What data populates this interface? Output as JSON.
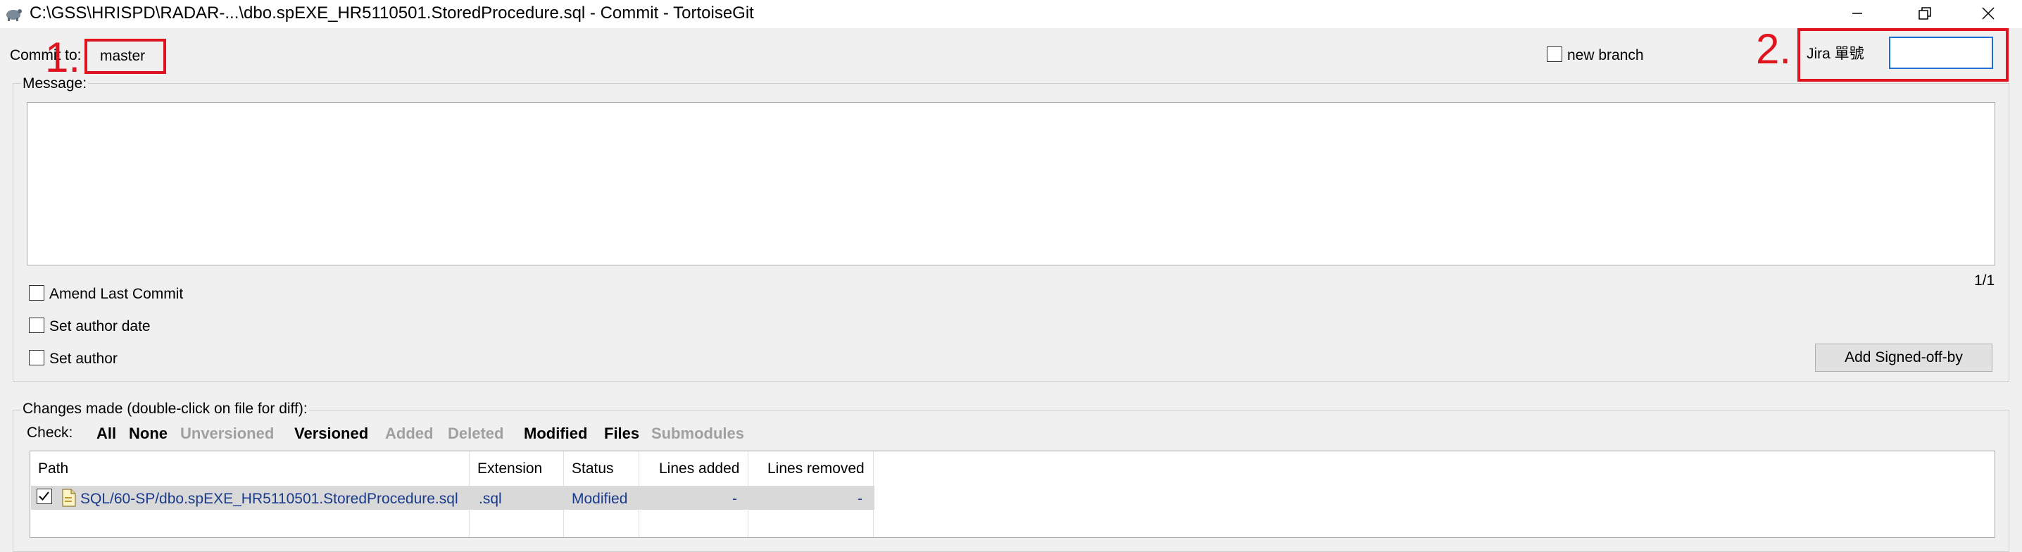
{
  "window": {
    "title": "C:\\GSS\\HRISPD\\RADAR-...\\dbo.spEXE_HR5110501.StoredProcedure.sql - Commit - TortoiseGit",
    "minimize_icon": "minimize-icon",
    "restore_icon": "restore-icon",
    "close_icon": "close-icon"
  },
  "commit": {
    "commit_to_label": "Commit to:",
    "branch": "master",
    "new_branch_label": "new branch",
    "jira_label": "Jira 單號",
    "jira_value": ""
  },
  "annotations": {
    "one": "1.",
    "two": "2."
  },
  "message": {
    "label": "Message:",
    "value": "",
    "counter": "1/1"
  },
  "options": {
    "amend": "Amend Last Commit",
    "set_author_date": "Set author date",
    "set_author": "Set author",
    "signed_off_button": "Add Signed-off-by"
  },
  "changes": {
    "group_label": "Changes made (double-click on file for diff):",
    "check_label": "Check:",
    "filters": [
      {
        "label": "All",
        "enabled": true
      },
      {
        "label": "None",
        "enabled": true
      },
      {
        "label": "Unversioned",
        "enabled": false
      },
      {
        "label": "Versioned",
        "enabled": true
      },
      {
        "label": "Added",
        "enabled": false
      },
      {
        "label": "Deleted",
        "enabled": false
      },
      {
        "label": "Modified",
        "enabled": true
      },
      {
        "label": "Files",
        "enabled": true
      },
      {
        "label": "Submodules",
        "enabled": false
      }
    ],
    "columns": [
      "Path",
      "Extension",
      "Status",
      "Lines added",
      "Lines removed"
    ],
    "rows": [
      {
        "checked": true,
        "path": "SQL/60-SP/dbo.spEXE_HR5110501.StoredProcedure.sql",
        "extension": ".sql",
        "status": "Modified",
        "lines_added": "-",
        "lines_removed": "-"
      }
    ]
  },
  "colors": {
    "annotation_red": "#e0141e",
    "focus_blue": "#1e6fd0",
    "file_text": "#1a3a8c"
  }
}
